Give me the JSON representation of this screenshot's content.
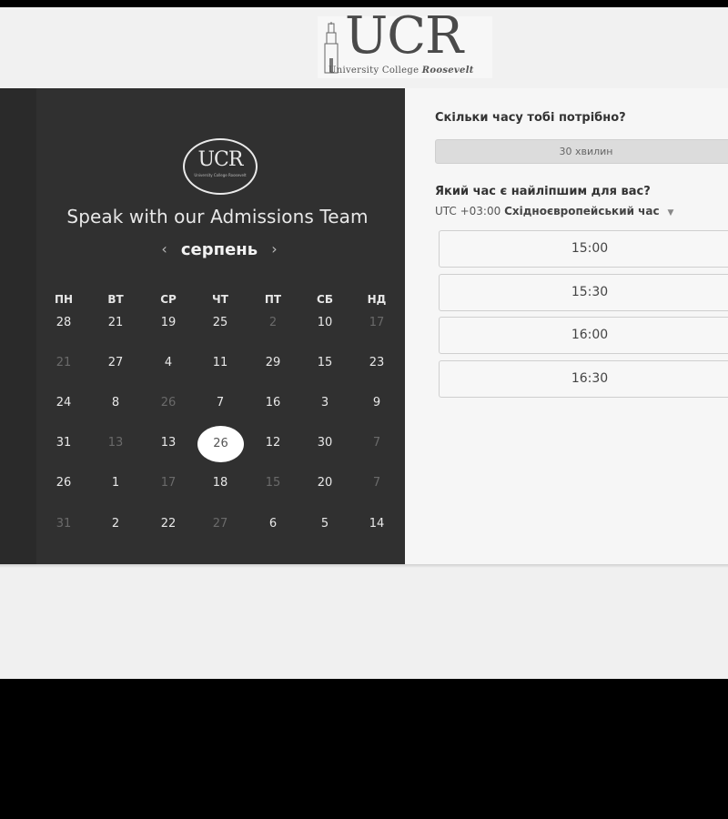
{
  "logo": {
    "wordmark": "UCR",
    "subtitle_prefix": "University College ",
    "subtitle_name": "Roosevelt",
    "badge_wordmark": "UCR",
    "badge_subtitle": "University College Roosevelt"
  },
  "calendar": {
    "title": "Speak with our Admissions Team",
    "month": "серпень",
    "prev_icon": "chevron-left-icon",
    "next_icon": "chevron-right-icon",
    "weekdays": [
      "ПН",
      "ВТ",
      "СР",
      "ЧТ",
      "ПТ",
      "СБ",
      "НД"
    ],
    "selected_day": "26",
    "rows": [
      [
        "28",
        "21",
        "19",
        "25",
        "2",
        "10",
        "17"
      ],
      [
        "21",
        "27",
        "4",
        "11",
        "29",
        "15",
        "23"
      ],
      [
        "24",
        "8",
        "26",
        "7",
        "16",
        "3",
        "9"
      ],
      [
        "31",
        "13",
        "13",
        "26",
        "12",
        "30",
        "7"
      ],
      [
        "26",
        "1",
        "17",
        "18",
        "15",
        "20",
        "7"
      ],
      [
        "31",
        "2",
        "22",
        "27",
        "6",
        "5",
        "14"
      ]
    ],
    "dim": [
      [
        false,
        false,
        false,
        false,
        true,
        false,
        true
      ],
      [
        true,
        false,
        false,
        false,
        false,
        false,
        false
      ],
      [
        false,
        false,
        true,
        false,
        false,
        false,
        false
      ],
      [
        false,
        true,
        false,
        false,
        false,
        false,
        true
      ],
      [
        false,
        false,
        true,
        false,
        true,
        false,
        true
      ],
      [
        true,
        false,
        false,
        true,
        false,
        false,
        false
      ]
    ]
  },
  "booking": {
    "duration_question": "Скільки часу тобі потрібно?",
    "duration_value": "30 хвилин",
    "time_question": "Який час є найліпшим для вас?",
    "timezone_offset": "UTC +03:00",
    "timezone_name": "Східноєвропейський час",
    "timezone_icon": "caret-down-icon",
    "slots": [
      "15:00",
      "15:30",
      "16:00",
      "16:30"
    ]
  },
  "colors": {
    "panel_dark": "#303030",
    "panel_light": "#f6f6f6",
    "selected_day_bg": "#ffffff"
  }
}
